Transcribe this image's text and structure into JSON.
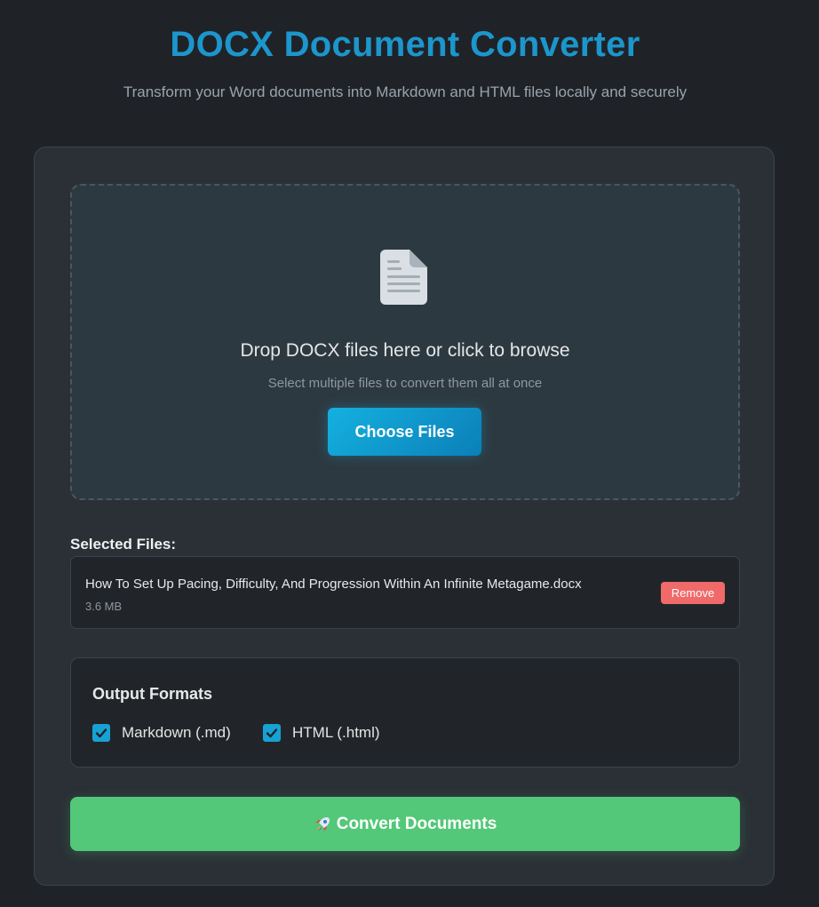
{
  "header": {
    "title": "DOCX Document Converter",
    "subtitle": "Transform your Word documents into Markdown and HTML files locally and securely"
  },
  "dropzone": {
    "icon": "document-icon",
    "title": "Drop DOCX files here or click to browse",
    "subtitle": "Select multiple files to convert them all at once",
    "button_label": "Choose Files"
  },
  "selected_files": {
    "label": "Selected Files:",
    "items": [
      {
        "name": "How To Set Up Pacing, Difficulty, And Progression Within An Infinite Metagame.docx",
        "size": "3.6 MB",
        "remove_label": "Remove"
      }
    ]
  },
  "output_formats": {
    "title": "Output Formats",
    "options": [
      {
        "label": "Markdown (.md)",
        "checked": true
      },
      {
        "label": "HTML (.html)",
        "checked": true
      }
    ]
  },
  "convert": {
    "icon": "rocket-icon",
    "label": "Convert Documents"
  },
  "colors": {
    "accent": "#1c96cc",
    "convert": "#52c878",
    "remove": "#f06a6a",
    "checkbox": "#17a2d4"
  }
}
